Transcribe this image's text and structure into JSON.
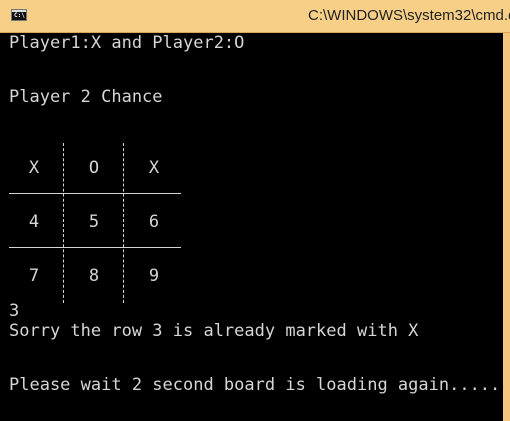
{
  "window": {
    "title": "C:\\WINDOWS\\system32\\cmd.e",
    "icon": "cmd-icon",
    "icon_label": "C:\\"
  },
  "console": {
    "line1": "Player1:X and Player2:O",
    "line2": "Player 2 Chance",
    "input_value": "3",
    "message1": "Sorry the row 3 is already marked with X",
    "message2": "Please wait 2 second board is loading again....."
  },
  "board": {
    "cells": [
      "X",
      "O",
      "X",
      "4",
      "5",
      "6",
      "7",
      "8",
      "9"
    ]
  },
  "colors": {
    "console_bg": "#000000",
    "console_text": "#d6d6d6",
    "title_bar": "#f7cf86"
  }
}
